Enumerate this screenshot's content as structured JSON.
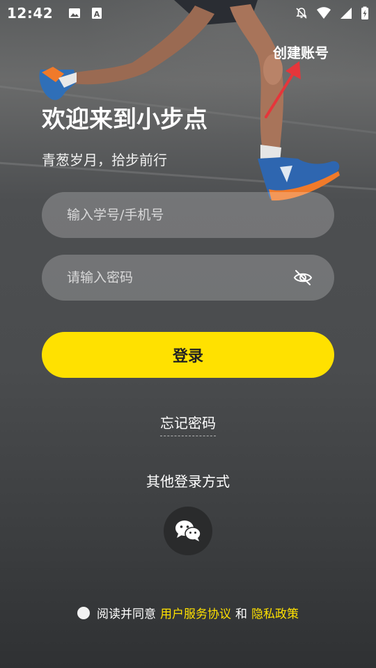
{
  "status_bar": {
    "time": "12:42",
    "icons_left": [
      "image-icon",
      "text-a-icon"
    ],
    "icons_right": [
      "notifications-off-icon",
      "wifi-icon",
      "signal-icon",
      "battery-charging-icon"
    ]
  },
  "header": {
    "create_account": "创建账号",
    "title": "欢迎来到小步点",
    "subtitle": "青葱岁月，拾步前行"
  },
  "form": {
    "account_placeholder": "输入学号/手机号",
    "account_value": "",
    "password_placeholder": "请输入密码",
    "password_value": "",
    "login_label": "登录"
  },
  "links": {
    "forgot_password": "忘记密码",
    "other_login": "其他登录方式"
  },
  "agreement": {
    "prefix": "阅读并同意",
    "service_link": "用户服务协议",
    "and": "和",
    "privacy_link": "隐私政策"
  },
  "colors": {
    "accent": "#ffe100",
    "annotation_arrow": "#e5363b"
  }
}
